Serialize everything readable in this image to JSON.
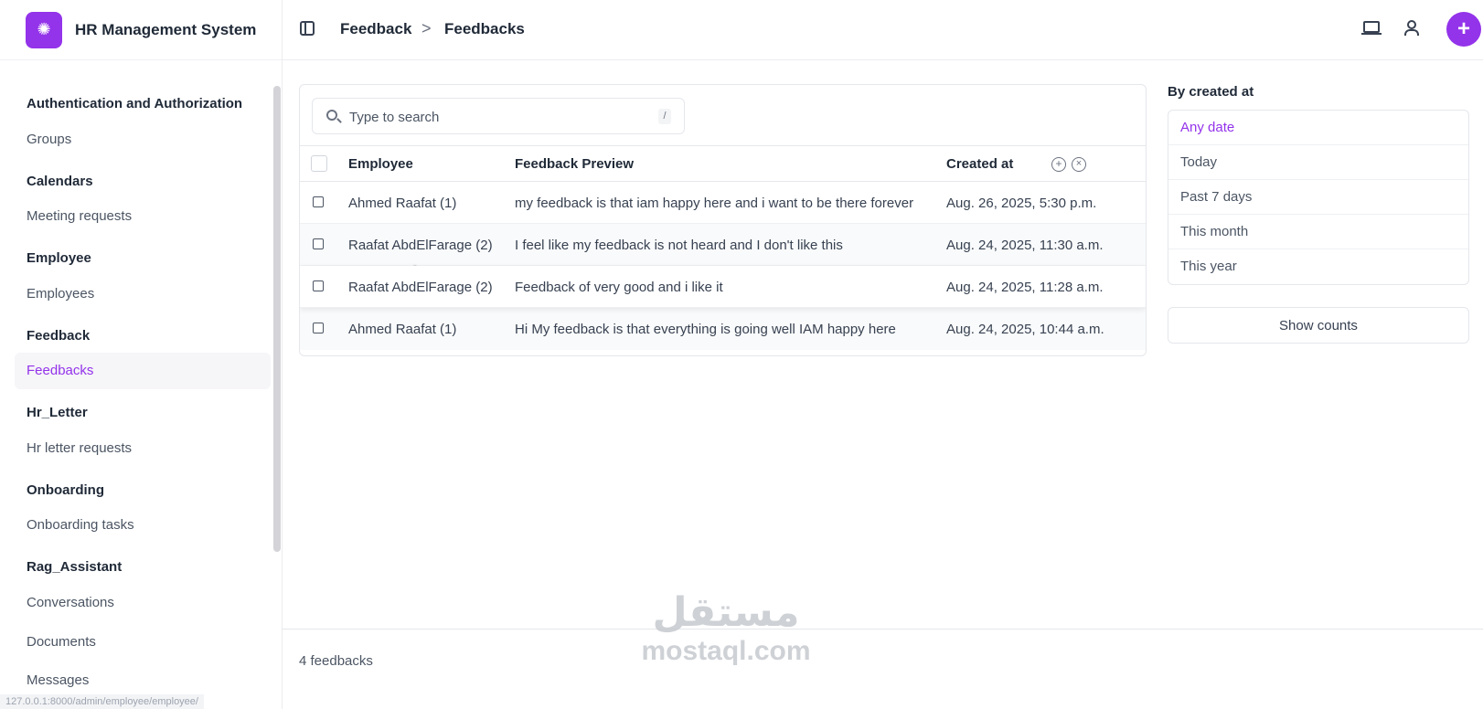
{
  "app": {
    "title": "HR Management System",
    "accent_color": "#9333ea"
  },
  "header": {
    "breadcrumb": [
      "Feedback",
      "Feedbacks"
    ],
    "breadcrumb_separator": ">",
    "add_label": "+"
  },
  "sidebar": {
    "sections": [
      {
        "title": "Authentication and Authorization",
        "items": [
          "Groups"
        ]
      },
      {
        "title": "Calendars",
        "items": [
          "Meeting requests"
        ]
      },
      {
        "title": "Employee",
        "items": [
          "Employees"
        ]
      },
      {
        "title": "Feedback",
        "items": [
          "Feedbacks"
        ]
      },
      {
        "title": "Hr_Letter",
        "items": [
          "Hr letter requests"
        ]
      },
      {
        "title": "Onboarding",
        "items": [
          "Onboarding tasks"
        ]
      },
      {
        "title": "Rag_Assistant",
        "items": [
          "Conversations",
          "Documents",
          "Messages"
        ]
      }
    ],
    "active_item": "Feedbacks",
    "status_url": "127.0.0.1:8000/admin/employee/employee/"
  },
  "search": {
    "placeholder": "Type to search",
    "shortcut": "/"
  },
  "table": {
    "columns": [
      "Employee",
      "Feedback Preview",
      "Created at"
    ],
    "rows": [
      {
        "employee": "Ahmed Raafat (1)",
        "preview": "my feedback is that iam happy here and i want to be there forever",
        "created": "Aug. 26, 2025, 5:30 p.m."
      },
      {
        "employee": "Raafat AbdElFarage (2)",
        "preview": "I feel like my feedback is not heard and I don't like this",
        "created": "Aug. 24, 2025, 11:30 a.m."
      },
      {
        "employee": "Raafat AbdElFarage (2)",
        "preview": "Feedback of very good and i like it",
        "created": "Aug. 24, 2025, 11:28 a.m."
      },
      {
        "employee": "Ahmed Raafat (1)",
        "preview": "Hi My feedback is that everything is going well IAM happy here",
        "created": "Aug. 24, 2025, 10:44 a.m."
      }
    ]
  },
  "filter": {
    "title": "By created at",
    "options": [
      "Any date",
      "Today",
      "Past 7 days",
      "This month",
      "This year"
    ],
    "selected": "Any date",
    "show_counts_label": "Show counts"
  },
  "footer": {
    "count_text": "4 feedbacks"
  },
  "watermark": {
    "arabic": "مستقل",
    "latin": "mostaql.com"
  }
}
